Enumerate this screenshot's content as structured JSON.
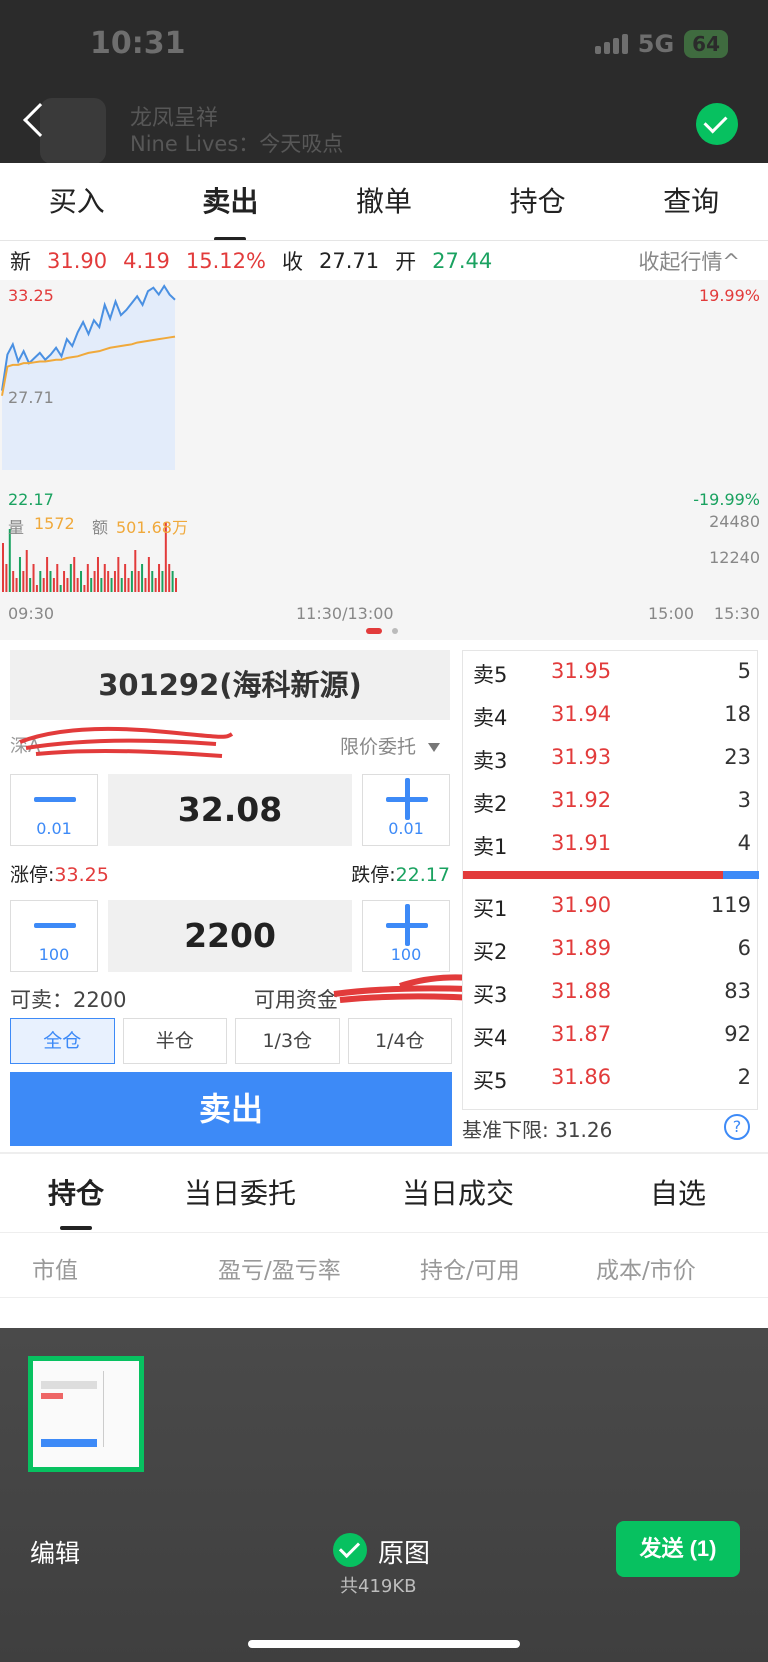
{
  "status_bar": {
    "time": "10:31",
    "network": "5G",
    "battery": "64"
  },
  "chat_header": {
    "name": "龙凤呈祥",
    "subtitle": "Nine Lives：今天吸点"
  },
  "tabs": [
    {
      "label": "买入",
      "active": false
    },
    {
      "label": "卖出",
      "active": true
    },
    {
      "label": "撤单",
      "active": false
    },
    {
      "label": "持仓",
      "active": false
    },
    {
      "label": "查询",
      "active": false
    }
  ],
  "quote": {
    "new_label": "新",
    "price": "31.90",
    "change": "4.19",
    "change_pct": "15.12%",
    "close_label": "收",
    "close": "27.71",
    "open_label": "开",
    "open": "27.44",
    "collapse_label": "收起行情^"
  },
  "chart_data": {
    "type": "line",
    "top_label": "33.25",
    "mid_label": "27.71",
    "bottom_label": "22.17",
    "top_pct": "19.99%",
    "bottom_pct": "-19.99%",
    "volume_label": "量",
    "volume": "1572",
    "amount_label": "额",
    "amount": "501.68万",
    "vol_ticks": [
      "24480",
      "12240"
    ],
    "x_labels": [
      "09:30",
      "11:30/13:00",
      "15:00",
      "15:30"
    ],
    "ylim": [
      22.17,
      33.25
    ],
    "series": [
      {
        "values": [
          26.8,
          28.9,
          29.5,
          28.5,
          29.1,
          28.4,
          28.7,
          29.0,
          28.6,
          28.9,
          29.3,
          28.8,
          29.8,
          29.4,
          30.2,
          30.8,
          30.1,
          30.9,
          30.5,
          31.8,
          31.0,
          32.0,
          31.2,
          31.5,
          31.9,
          32.3,
          31.8,
          32.6,
          32.8,
          32.4,
          32.9,
          32.4,
          32.1
        ]
      },
      {
        "values": [
          26.5,
          28.2,
          28.3,
          28.3,
          28.4,
          28.4,
          28.45,
          28.5,
          28.5,
          28.55,
          28.6,
          28.6,
          28.7,
          28.75,
          28.8,
          28.9,
          29.0,
          29.05,
          29.1,
          29.2,
          29.3,
          29.35,
          29.4,
          29.45,
          29.5,
          29.6,
          29.65,
          29.7,
          29.75,
          29.8,
          29.85,
          29.9,
          29.95
        ]
      }
    ],
    "volumes": [
      7,
      4,
      9,
      3,
      2,
      5,
      3,
      6,
      2,
      4,
      1,
      3,
      2,
      5,
      3,
      2,
      4,
      1,
      3,
      2,
      4,
      5,
      2,
      3,
      1,
      4,
      2,
      3,
      5,
      2,
      4,
      3,
      2,
      3,
      5,
      2,
      4,
      2,
      3,
      6,
      3,
      4,
      2,
      5,
      3,
      2,
      4,
      3,
      10,
      4,
      3,
      2
    ],
    "colors": {
      "price": "#4a90e2",
      "avg": "#f0a93b",
      "fill": "#e3ecfa",
      "vol_up": "#e23b3b",
      "vol_down": "#1aa260"
    }
  },
  "stock": {
    "code_name": "301292(海科新源)",
    "market": "深A",
    "order_type": "限价委托"
  },
  "price_stepper": {
    "minus": "0.01",
    "value": "32.08",
    "plus": "0.01"
  },
  "limits": {
    "up_label": "涨停:",
    "up": "33.25",
    "down_label": "跌停:",
    "down": "22.17"
  },
  "qty_stepper": {
    "minus": "100",
    "value": "2200",
    "plus": "100"
  },
  "available": {
    "sellable_label": "可卖：",
    "sellable": "2200",
    "funds_label": "可用资金"
  },
  "position_buttons": [
    {
      "label": "全仓",
      "active": true
    },
    {
      "label": "半仓",
      "active": false
    },
    {
      "label": "1/3仓",
      "active": false
    },
    {
      "label": "1/4仓",
      "active": false
    }
  ],
  "sell_button": "卖出",
  "order_book": {
    "asks": [
      {
        "label": "卖5",
        "price": "31.95",
        "vol": "5"
      },
      {
        "label": "卖4",
        "price": "31.94",
        "vol": "18"
      },
      {
        "label": "卖3",
        "price": "31.93",
        "vol": "23"
      },
      {
        "label": "卖2",
        "price": "31.92",
        "vol": "3"
      },
      {
        "label": "卖1",
        "price": "31.91",
        "vol": "4"
      }
    ],
    "bids": [
      {
        "label": "买1",
        "price": "31.90",
        "vol": "119"
      },
      {
        "label": "买2",
        "price": "31.89",
        "vol": "6"
      },
      {
        "label": "买3",
        "price": "31.88",
        "vol": "83"
      },
      {
        "label": "买4",
        "price": "31.87",
        "vol": "92"
      },
      {
        "label": "买5",
        "price": "31.86",
        "vol": "2"
      }
    ],
    "bid_ratio": 0.88,
    "baseline_label": "基准下限:",
    "baseline": "31.26"
  },
  "bottom_tabs": [
    {
      "label": "持仓",
      "active": true
    },
    {
      "label": "当日委托",
      "active": false
    },
    {
      "label": "当日成交",
      "active": false
    },
    {
      "label": "自选",
      "active": false
    }
  ],
  "columns": [
    "市值",
    "盈亏/盈亏率",
    "持仓/可用",
    "成本/市价"
  ],
  "image_picker": {
    "edit": "编辑",
    "original": "原图",
    "size": "共419KB",
    "send": "发送 (1)"
  }
}
